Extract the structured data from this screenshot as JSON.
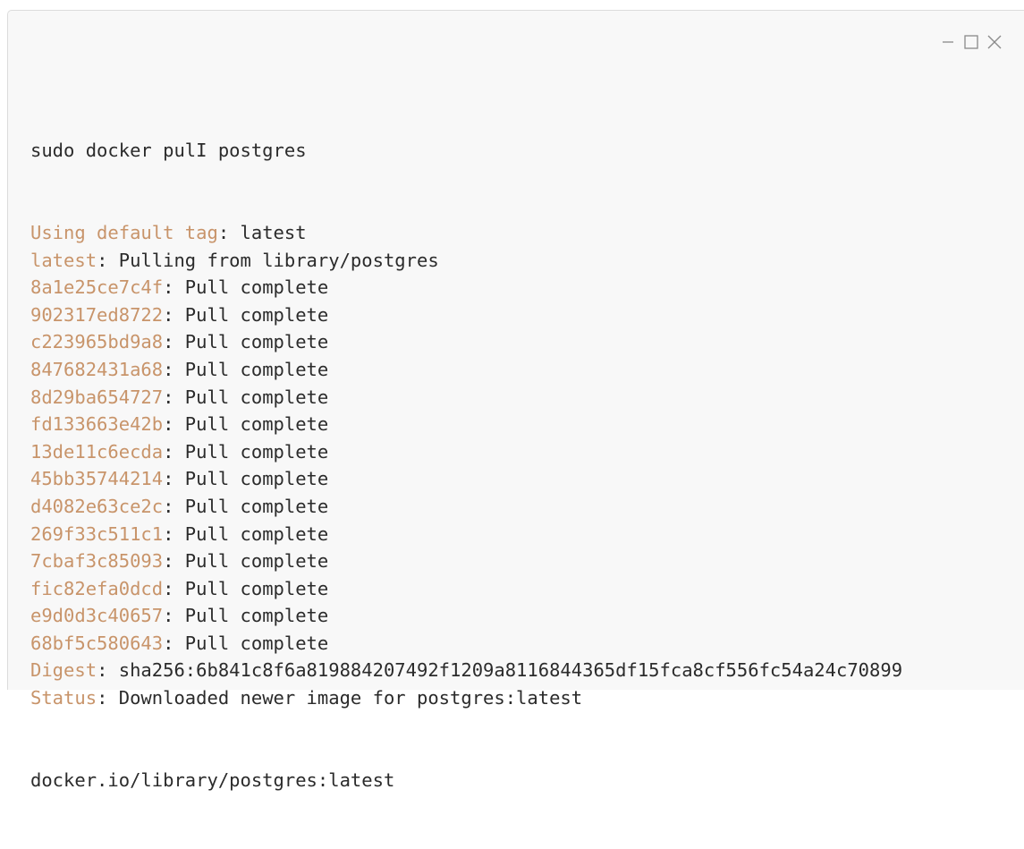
{
  "window": {
    "controls": [
      {
        "name": "minimize",
        "icon": "minimize-icon"
      },
      {
        "name": "maximize",
        "icon": "maximize-icon"
      },
      {
        "name": "close",
        "icon": "close-icon"
      }
    ]
  },
  "colors": {
    "background": "#f8f8f8",
    "text": "#2b2b2b",
    "accent": "#c8946a",
    "controls": "#8a8a8a"
  },
  "terminal": {
    "command": "sudo docker pulI postgres",
    "lines": [
      {
        "key": "Using default tag",
        "text": ": latest"
      },
      {
        "key": "latest",
        "text": ": Pulling from library/postgres"
      },
      {
        "key": "8a1e25ce7c4f",
        "text": ": Pull complete"
      },
      {
        "key": "902317ed8722",
        "text": ": Pull complete"
      },
      {
        "key": "c223965bd9a8",
        "text": ": Pull complete"
      },
      {
        "key": "847682431a68",
        "text": ": Pull complete"
      },
      {
        "key": "8d29ba654727",
        "text": ": Pull complete"
      },
      {
        "key": "fd133663e42b",
        "text": ": Pull complete"
      },
      {
        "key": "13de11c6ecda",
        "text": ": Pull complete"
      },
      {
        "key": "45bb35744214",
        "text": ": Pull complete"
      },
      {
        "key": "d4082e63ce2c",
        "text": ": Pull complete"
      },
      {
        "key": "269f33c511c1",
        "text": ": Pull complete"
      },
      {
        "key": "7cbaf3c85093",
        "text": ": Pull complete"
      },
      {
        "key": "fic82efa0dcd",
        "text": ": Pull complete"
      },
      {
        "key": "e9d0d3c40657",
        "text": ": Pull complete"
      },
      {
        "key": "68bf5c580643",
        "text": ": Pull complete"
      },
      {
        "key": "Digest",
        "text": ": sha256:6b841c8f6a819884207492f1209a8116844365df15fca8cf556fc54a24c70899"
      },
      {
        "key": "Status",
        "text": ": Downloaded newer image for postgres:latest"
      }
    ],
    "final": "docker.io/library/postgres:latest"
  }
}
